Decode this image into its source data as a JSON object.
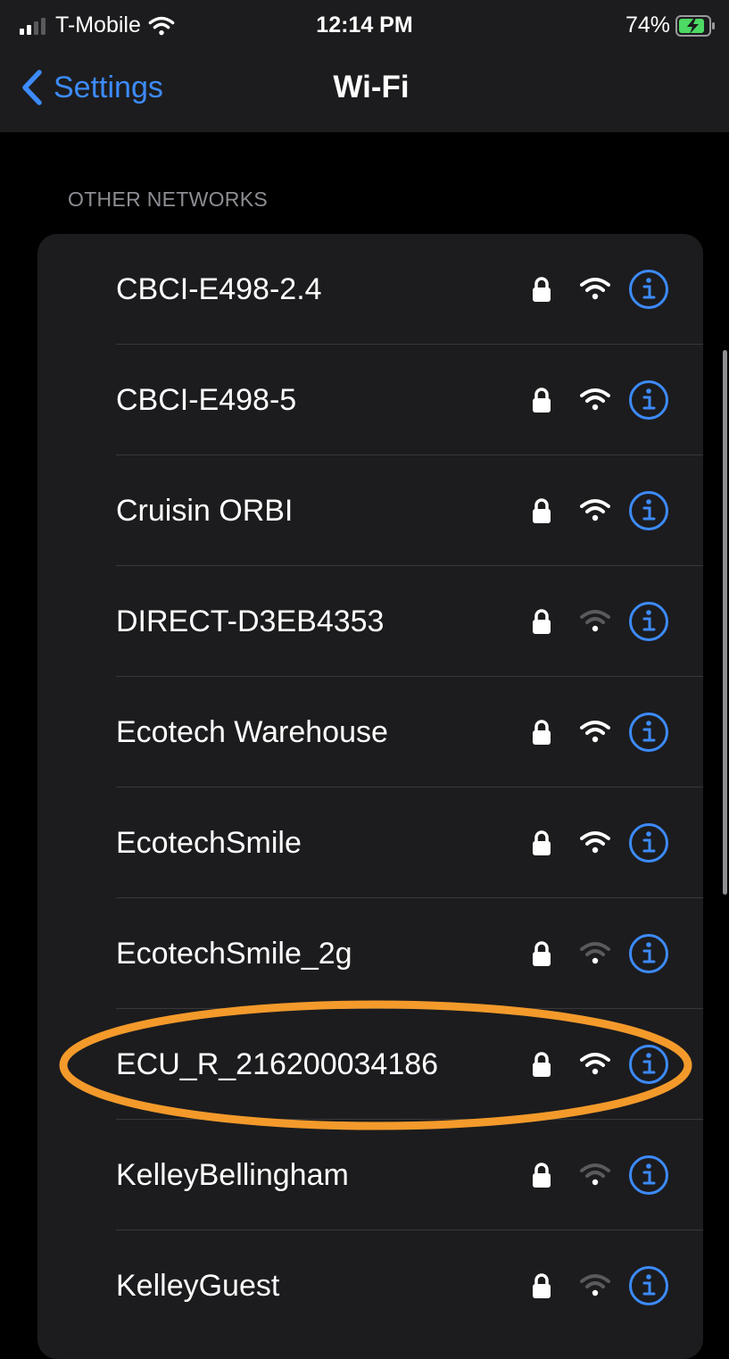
{
  "status_bar": {
    "carrier": "T-Mobile",
    "time": "12:14 PM",
    "battery": "74%"
  },
  "nav": {
    "back_label": "Settings",
    "title": "Wi-Fi"
  },
  "section_header": "OTHER NETWORKS",
  "networks": [
    {
      "name": "CBCI-E498-2.4",
      "secured": true,
      "signal_bars": 3
    },
    {
      "name": "CBCI-E498-5",
      "secured": true,
      "signal_bars": 3
    },
    {
      "name": "Cruisin ORBI",
      "secured": true,
      "signal_bars": 3
    },
    {
      "name": "DIRECT-D3EB4353",
      "secured": true,
      "signal_bars": 1
    },
    {
      "name": "Ecotech Warehouse",
      "secured": true,
      "signal_bars": 3
    },
    {
      "name": "EcotechSmile",
      "secured": true,
      "signal_bars": 3
    },
    {
      "name": "EcotechSmile_2g",
      "secured": true,
      "signal_bars": 1
    },
    {
      "name": "ECU_R_216200034186",
      "secured": true,
      "signal_bars": 3,
      "highlighted": true
    },
    {
      "name": "KelleyBellingham",
      "secured": true,
      "signal_bars": 1
    },
    {
      "name": "KelleyGuest",
      "secured": true,
      "signal_bars": 1
    }
  ],
  "icons": {
    "back": "chevron-left-icon",
    "lock": "lock-icon",
    "wifi": "wifi-icon",
    "info": "info-icon"
  },
  "colors": {
    "accent": "#3d8bfd",
    "highlight": "#f39a2b",
    "battery_charging": "#4cd964"
  }
}
